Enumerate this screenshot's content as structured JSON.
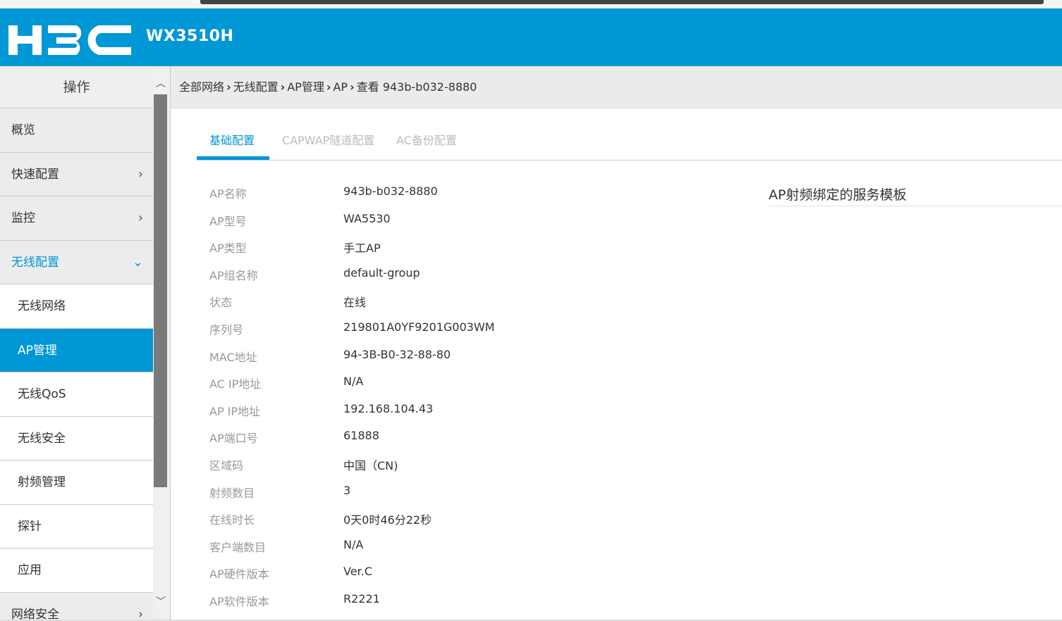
{
  "header": {
    "logo_text": "H3C",
    "model": "WX3510H",
    "bg_color": "#0097d6"
  },
  "sidebar": {
    "title": "操作",
    "items": [
      {
        "label": "概览",
        "type": "top",
        "chevron": ""
      },
      {
        "label": "快速配置",
        "type": "top",
        "chevron": "›"
      },
      {
        "label": "监控",
        "type": "top",
        "chevron": "›"
      },
      {
        "label": "无线配置",
        "type": "open",
        "chevron": "⌄"
      },
      {
        "label": "无线网络",
        "type": "sub",
        "chevron": ""
      },
      {
        "label": "AP管理",
        "type": "active",
        "chevron": ""
      },
      {
        "label": "无线QoS",
        "type": "sub",
        "chevron": ""
      },
      {
        "label": "无线安全",
        "type": "sub",
        "chevron": ""
      },
      {
        "label": "射频管理",
        "type": "sub",
        "chevron": ""
      },
      {
        "label": "探针",
        "type": "sub",
        "chevron": ""
      },
      {
        "label": "应用",
        "type": "sub",
        "chevron": ""
      },
      {
        "label": "网络安全",
        "type": "top",
        "chevron": "›"
      }
    ]
  },
  "breadcrumb": [
    "全部网络",
    "无线配置",
    "AP管理",
    "AP",
    "查看 943b-b032-8880"
  ],
  "tabs": [
    {
      "label": "基础配置",
      "active": true
    },
    {
      "label": "CAPWAP隧道配置",
      "active": false
    },
    {
      "label": "AC备份配置",
      "active": false
    }
  ],
  "info": [
    {
      "key": "AP名称",
      "value": "943b-b032-8880"
    },
    {
      "key": "AP型号",
      "value": "WA5530"
    },
    {
      "key": "AP类型",
      "value": "手工AP"
    },
    {
      "key": "AP组名称",
      "value": "default-group"
    },
    {
      "key": "状态",
      "value": "在线"
    },
    {
      "key": "序列号",
      "value": "219801A0YF9201G003WM"
    },
    {
      "key": "MAC地址",
      "value": "94-3B-B0-32-88-80"
    },
    {
      "key": "AC IP地址",
      "value": "N/A"
    },
    {
      "key": "AP IP地址",
      "value": "192.168.104.43"
    },
    {
      "key": "AP端口号",
      "value": "61888"
    },
    {
      "key": "区域码",
      "value": "中国（CN)"
    },
    {
      "key": "射频数目",
      "value": "3"
    },
    {
      "key": "在线时长",
      "value": "0天0时46分22秒"
    },
    {
      "key": "客户端数目",
      "value": "N/A"
    },
    {
      "key": "AP硬件版本",
      "value": "Ver.C"
    },
    {
      "key": "AP软件版本",
      "value": "R2221"
    }
  ],
  "right_panel": {
    "title": "AP射频绑定的服务模板"
  }
}
